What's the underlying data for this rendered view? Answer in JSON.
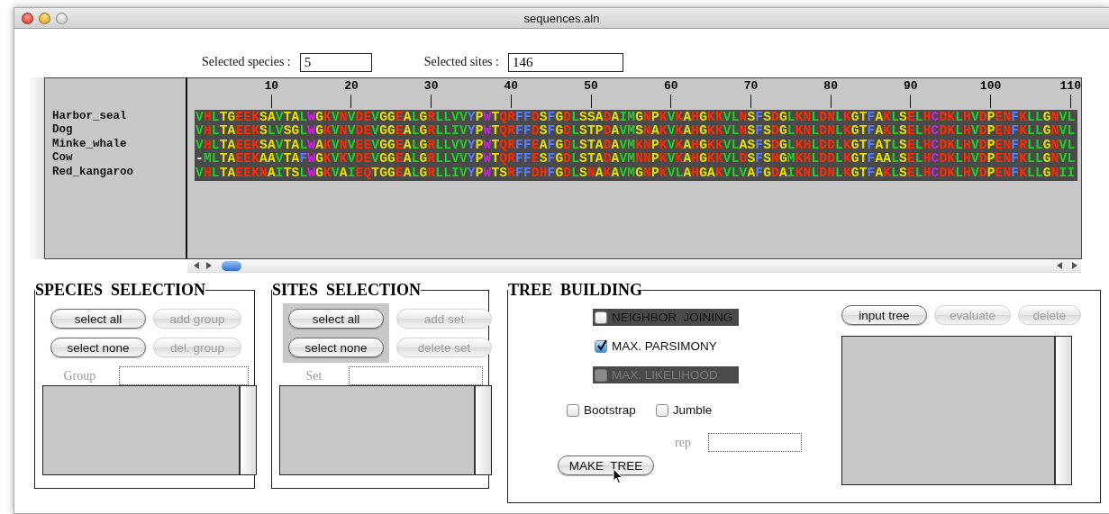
{
  "window": {
    "title": "sequences.aln"
  },
  "selection_summary": [
    {
      "label": "Selected species :",
      "value": "5"
    },
    {
      "label": "Selected sites :",
      "value": "146"
    }
  ],
  "alignment": {
    "ruler": [
      "10",
      "20",
      "30",
      "40",
      "50",
      "60",
      "70",
      "80",
      "90",
      "100",
      "110"
    ],
    "species": [
      {
        "name": "Harbor_seal",
        "sequence": "VHLTGEEKSAVTALWGKVNVDEVGGEALGRLLVVYPWTQRFFDSFGDLSSADAIMGNPKVKAHGKKVLNSFSDGLKNLDNLKGTFAKLSELHCDKLHVDPENFKLLGNVL"
      },
      {
        "name": "Dog",
        "sequence": "VHLTAEEKSLVSGLWGKVNVDEVGGEALGRLLIVYPWTQRFFDSFGDLSTPDAVMSNAKVKAHGKKVLNSFSDGLKNLDNLKGTFAKLSELHCDKLHVDPENFKLLGNVL"
      },
      {
        "name": "Minke_whale",
        "sequence": "VHLTAEEKSAVTALWAKVNVEEVGGEALGRLLVVYPWTQRFFEAFGDLSTADAVMKNPKVKAHGKKVLASFSDGLKHLDDLKGTFATLSELHCDKLHVDPENFRLLGNVL"
      },
      {
        "name": "Cow",
        "sequence": "-MLTAEEKAAVTAFWGKVKVDEVGGEALGRLLVVYPWTQRFFESFGDLSTADAVMNNPKVKAHGKKVLDSFSNGMKHLDDLKGTFAALSELHCDKLHVDPENFKLLGNVL"
      },
      {
        "name": "Red_kangaroo",
        "sequence": "VHLTAEEKNAITSLWGKVAIEQTGGEALGRLLIVYPWTSRFFDHFGDLSNAKAVMGNPKVLAHGAKVLVAFGDAIKNLDNLKGTFAKLSELHCDKLHVDPENFKLLGNII"
      }
    ]
  },
  "species_selection": {
    "title": "SPECIES  SELECTION",
    "button_groups": [
      {
        "highlighted": false,
        "buttons": [
          {
            "label": "select all",
            "disabled": false
          },
          {
            "label": "select none",
            "disabled": false
          }
        ]
      },
      {
        "highlighted": false,
        "buttons": [
          {
            "label": "add group",
            "disabled": true
          },
          {
            "label": "del. group",
            "disabled": true
          }
        ]
      }
    ],
    "field": {
      "label": "Group",
      "disabled": true
    }
  },
  "sites_selection": {
    "title": "SITES  SELECTION",
    "button_groups": [
      {
        "highlighted": true,
        "buttons": [
          {
            "label": "select all",
            "disabled": false
          },
          {
            "label": "select none",
            "disabled": false
          }
        ]
      },
      {
        "highlighted": false,
        "buttons": [
          {
            "label": "add set",
            "disabled": true
          },
          {
            "label": "delete set",
            "disabled": true
          }
        ]
      }
    ],
    "field": {
      "label": "Set",
      "disabled": true
    }
  },
  "tree_building": {
    "title": "TREE  BUILDING",
    "methods": [
      {
        "label": "NEIGHBOR  JOINING",
        "checked": false,
        "disabled": false,
        "shaded": true
      },
      {
        "label": "MAX. PARSIMONY",
        "checked": true,
        "disabled": false,
        "shaded": false
      },
      {
        "label": "MAX. LIKELIHOOD",
        "checked": false,
        "disabled": true,
        "shaded": true
      }
    ],
    "options": [
      {
        "label": "Bootstrap",
        "checked": false
      },
      {
        "label": "Jumble",
        "checked": false
      }
    ],
    "rep_field": {
      "label": "rep",
      "disabled": true
    },
    "make_button": {
      "label": "MAKE  TREE",
      "disabled": false
    },
    "tree_buttons": [
      {
        "label": "input tree",
        "disabled": false
      },
      {
        "label": "evaluate",
        "disabled": true
      },
      {
        "label": "delete",
        "disabled": true
      }
    ]
  }
}
